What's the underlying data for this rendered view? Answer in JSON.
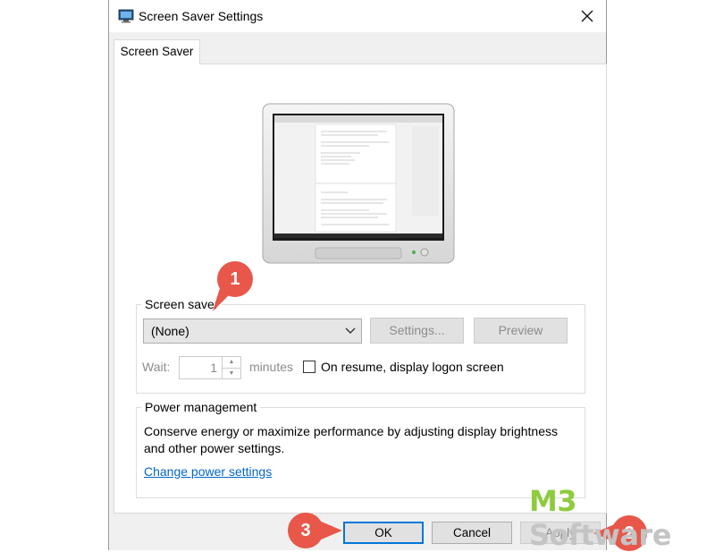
{
  "window": {
    "title": "Screen Saver Settings"
  },
  "tabs": [
    {
      "label": "Screen Saver"
    }
  ],
  "screen_saver": {
    "group_label": "Screen saver",
    "selected": "(None)",
    "settings_label": "Settings...",
    "preview_label": "Preview",
    "wait_label": "Wait:",
    "wait_value": "1",
    "minutes_label": "minutes",
    "resume_label": "On resume, display logon screen",
    "resume_checked": false
  },
  "power": {
    "group_label": "Power management",
    "description": "Conserve energy or maximize performance by adjusting display brightness and other power settings.",
    "link_label": "Change power settings"
  },
  "footer": {
    "ok_label": "OK",
    "cancel_label": "Cancel",
    "apply_label": "Apply"
  },
  "annotations": {
    "marker1": "1",
    "marker2": "2",
    "marker3": "3"
  },
  "watermark": {
    "part1": "M3",
    "part2": " Software"
  },
  "colors": {
    "accent": "#0078d7",
    "marker": "#e8574a",
    "link": "#0066cc",
    "brand_green": "#8ecb3e"
  }
}
